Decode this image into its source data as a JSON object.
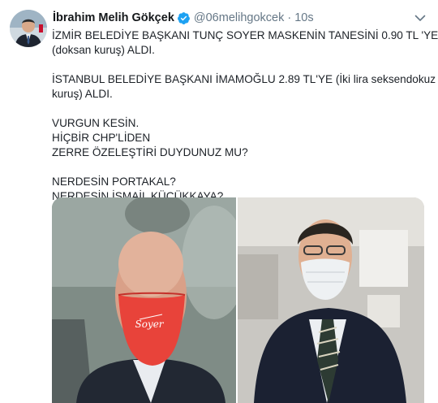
{
  "tweet": {
    "author": {
      "display_name": "İbrahim Melih Gökçek",
      "handle": "@06melihgokcek",
      "verified": true
    },
    "separator": "·",
    "timestamp": "10s",
    "lines": [
      "İZMİR BELEDİYE BAŞKANI TUNÇ SOYER MASKENİN TANESİNİ 0.90 TL 'YE",
      "(doksan kuruş) ALDI.",
      "",
      "İSTANBUL BELEDİYE BAŞKANI İMAMOĞLU 2.89 TL'YE (İki lira seksendokuz",
      "kuruş) ALDI.",
      "",
      "VURGUN KESİN.",
      "HİÇBİR CHP'LİDEN",
      "ZERRE ÖZELEŞTİRİ DUYDUNUZ MU?",
      "",
      "NERDESİN PORTAKAL?",
      "NERDESİN İSMAİL KÜÇÜKKAYA?"
    ],
    "media": {
      "mask_text": "Soyer"
    }
  },
  "icons": {
    "verified": "verified-badge-icon",
    "more": "chevron-down-icon"
  },
  "colors": {
    "verified_blue": "#1da1f2",
    "secondary_text": "#657786",
    "red_mask": "#e8433a"
  }
}
